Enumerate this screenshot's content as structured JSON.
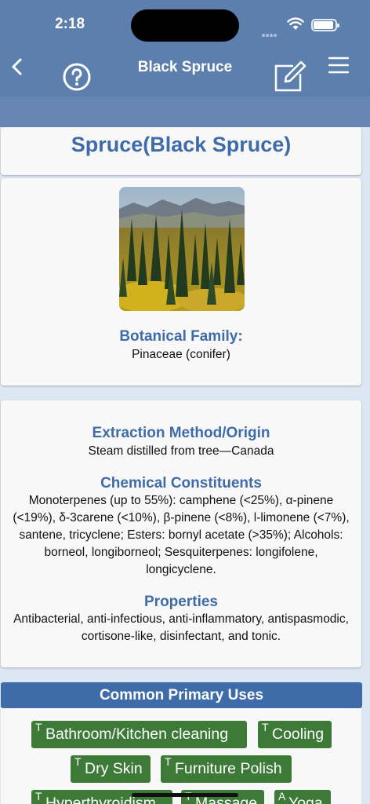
{
  "status": {
    "time": "2:18"
  },
  "nav": {
    "title": "Black Spruce"
  },
  "header": {
    "title": "Spruce(Black Spruce)"
  },
  "family": {
    "heading": "Botanical Family:",
    "value": "Pinaceae (conifer)"
  },
  "extraction": {
    "heading": "Extraction Method/Origin",
    "value": "Steam distilled from tree—Canada"
  },
  "chemical": {
    "heading": "Chemical Constituents",
    "value": "Monoterpenes (up to 55%): camphene (<25%), α-pinene (<19%), δ-3carene (<10%), β-pinene (<8%), l-limonene (<7%), santene, tricyclene; Esters: bornyl acetate (>35%); Alcohols: borneol, longiborneol; Sesquiterpenes: longifolene, longicyclene."
  },
  "properties": {
    "heading": "Properties",
    "value": "Antibacterial, anti-infectious, anti-inflammatory, antispasmodic, cortisone-like, disinfectant, and tonic."
  },
  "uses": {
    "heading": "Common Primary Uses",
    "tags": [
      {
        "prefix": "T",
        "label": "Bathroom/Kitchen cleaning"
      },
      {
        "prefix": "T",
        "label": "Cooling"
      },
      {
        "prefix": "T",
        "label": "Dry Skin"
      },
      {
        "prefix": "T",
        "label": "Furniture Polish"
      },
      {
        "prefix": "T",
        "label": "Hyperthyroidism"
      },
      {
        "prefix": "T",
        "label": "Massage"
      },
      {
        "prefix": "A",
        "label": "Yoga"
      }
    ]
  },
  "colors": {
    "nav": "#5d7fad",
    "accent": "#3f6ca9",
    "tag": "#3d7a37"
  },
  "icons": [
    "back-chevron-icon",
    "help-circle-icon",
    "edit-note-icon",
    "hamburger-menu-icon"
  ]
}
